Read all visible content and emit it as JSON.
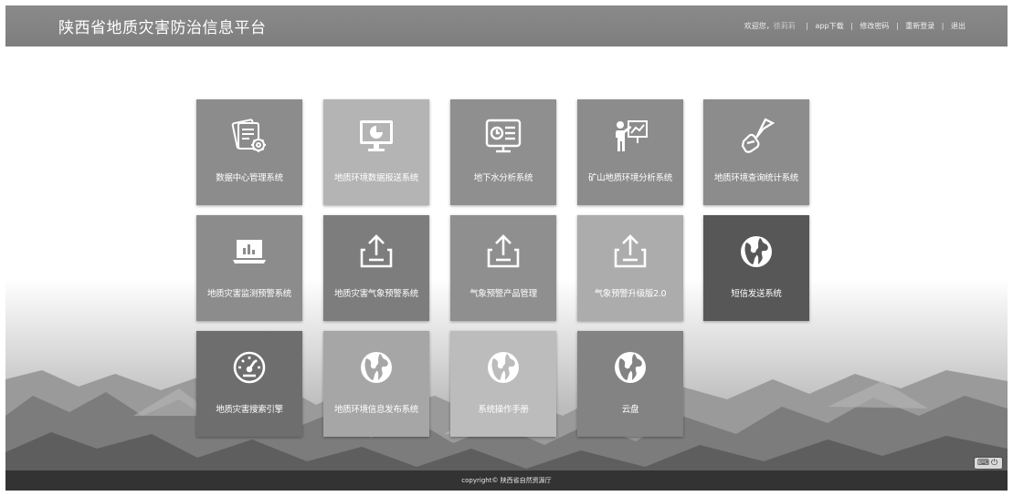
{
  "header": {
    "title": "陕西省地质灾害防治信息平台",
    "welcome": "欢迎您，",
    "username": "徐莉莉",
    "links": [
      "app下载",
      "修改密码",
      "重新登录",
      "退出"
    ]
  },
  "tiles": [
    {
      "label": "数据中心管理系统",
      "icon": "document-gear-icon",
      "color": "#8c8c8c"
    },
    {
      "label": "地质环境数据报送系统",
      "icon": "monitor-pie-chart-icon",
      "color": "#b4b4b4"
    },
    {
      "label": "地下水分析系统",
      "icon": "clock-list-screen-icon",
      "color": "#8f8f8f"
    },
    {
      "label": "矿山地质环境分析系统",
      "icon": "presenter-chart-icon",
      "color": "#8c8c8c"
    },
    {
      "label": "地质环境查询统计系统",
      "icon": "hand-flag-icon",
      "color": "#8c8c8c"
    },
    {
      "label": "地质灾害监测预警系统",
      "icon": "laptop-bar-chart-icon",
      "color": "#8c8c8c"
    },
    {
      "label": "地质灾害气象预警系统",
      "icon": "upload-tray-icon",
      "color": "#7d7d7d"
    },
    {
      "label": "气象预警产品管理",
      "icon": "upload-tray-icon",
      "color": "#8f8f8f"
    },
    {
      "label": "气象预警升级版2.0",
      "icon": "upload-tray-icon",
      "color": "#acacac"
    },
    {
      "label": "短信发送系统",
      "icon": "globe-icon",
      "color": "#575757"
    },
    {
      "label": "地质灾害搜索引擎",
      "icon": "speedometer-icon",
      "color": "#6e6e6e"
    },
    {
      "label": "地质环境信息发布系统",
      "icon": "globe-icon",
      "color": "#a6a6a6"
    },
    {
      "label": "系统操作手册",
      "icon": "globe-icon",
      "color": "#bcbcbc"
    },
    {
      "label": "云盘",
      "icon": "globe-icon",
      "color": "#838383"
    }
  ],
  "footer": {
    "copyright": "copyright© 陕西省自然资源厅"
  }
}
